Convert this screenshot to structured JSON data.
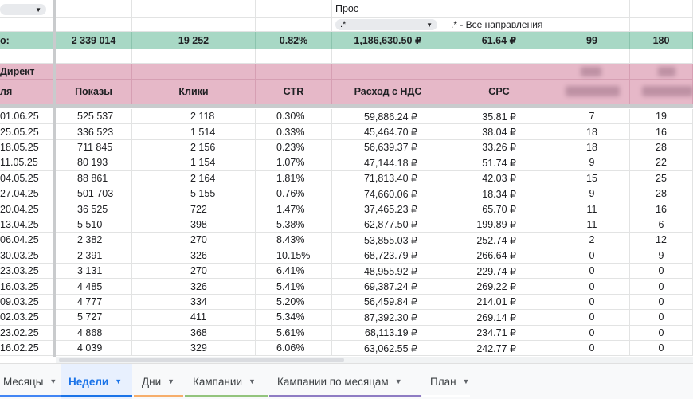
{
  "filter_row": {
    "label": "Прос",
    "value": ".*",
    "hint": ".* - Все направления"
  },
  "totals": {
    "label": "о:",
    "values": [
      "2 339 014",
      "19 252",
      "0.82%",
      "1,186,630.50 ₽",
      "61.64 ₽",
      "99",
      "180"
    ]
  },
  "section_title": "Директ",
  "headers": [
    "ля",
    "Показы",
    "Клики",
    "CTR",
    "Расход с НДС",
    "CPC"
  ],
  "rows": [
    [
      "01.06.25",
      "525 537",
      "2 118",
      "0.30%",
      "59,886.24 ₽",
      "35.81 ₽",
      "7",
      "19"
    ],
    [
      "25.05.25",
      "336 523",
      "1 514",
      "0.33%",
      "45,464.70 ₽",
      "38.04 ₽",
      "18",
      "16"
    ],
    [
      "18.05.25",
      "711 845",
      "2 156",
      "0.23%",
      "56,639.37 ₽",
      "33.26 ₽",
      "18",
      "28"
    ],
    [
      "11.05.25",
      "80 193",
      "1 154",
      "1.07%",
      "47,144.18 ₽",
      "51.74 ₽",
      "9",
      "22"
    ],
    [
      "04.05.25",
      "88 861",
      "2 164",
      "1.81%",
      "71,813.40 ₽",
      "42.03 ₽",
      "15",
      "25"
    ],
    [
      "27.04.25",
      "501 703",
      "5 155",
      "0.76%",
      "74,660.06 ₽",
      "18.34 ₽",
      "9",
      "28"
    ],
    [
      "20.04.25",
      "36 525",
      "722",
      "1.47%",
      "37,465.23 ₽",
      "65.70 ₽",
      "11",
      "16"
    ],
    [
      "13.04.25",
      "5 510",
      "398",
      "5.38%",
      "62,877.50 ₽",
      "199.89 ₽",
      "11",
      "6"
    ],
    [
      "06.04.25",
      "2 382",
      "270",
      "8.43%",
      "53,855.03 ₽",
      "252.74 ₽",
      "2",
      "12"
    ],
    [
      "30.03.25",
      "2 391",
      "326",
      "10.15%",
      "68,723.79 ₽",
      "266.64 ₽",
      "0",
      "9"
    ],
    [
      "23.03.25",
      "3 131",
      "270",
      "6.41%",
      "48,955.92 ₽",
      "229.74 ₽",
      "0",
      "0"
    ],
    [
      "16.03.25",
      "4 485",
      "326",
      "5.41%",
      "69,387.24 ₽",
      "269.22 ₽",
      "0",
      "0"
    ],
    [
      "09.03.25",
      "4 777",
      "334",
      "5.20%",
      "56,459.84 ₽",
      "214.01 ₽",
      "0",
      "0"
    ],
    [
      "02.03.25",
      "5 727",
      "411",
      "5.34%",
      "87,392.30 ₽",
      "269.14 ₽",
      "0",
      "0"
    ],
    [
      "23.02.25",
      "4 868",
      "368",
      "5.61%",
      "68,113.19 ₽",
      "234.71 ₽",
      "0",
      "0"
    ],
    [
      "16.02.25",
      "4 039",
      "329",
      "6.06%",
      "63,062.55 ₽",
      "242.77 ₽",
      "0",
      "0"
    ]
  ],
  "tabs": [
    {
      "label": "Месяцы",
      "color": "#4285f4",
      "active": false
    },
    {
      "label": "Недели",
      "color": "#1a73e8",
      "active": true
    },
    {
      "label": "Дни",
      "color": "#f6ae6b",
      "active": false
    },
    {
      "label": "Кампании",
      "color": "#93c47d",
      "active": false
    },
    {
      "label": "Кампании по месяцам",
      "color": "#8e7cc3",
      "active": false
    },
    {
      "label": "План",
      "color": "#ffffff",
      "active": false
    }
  ]
}
